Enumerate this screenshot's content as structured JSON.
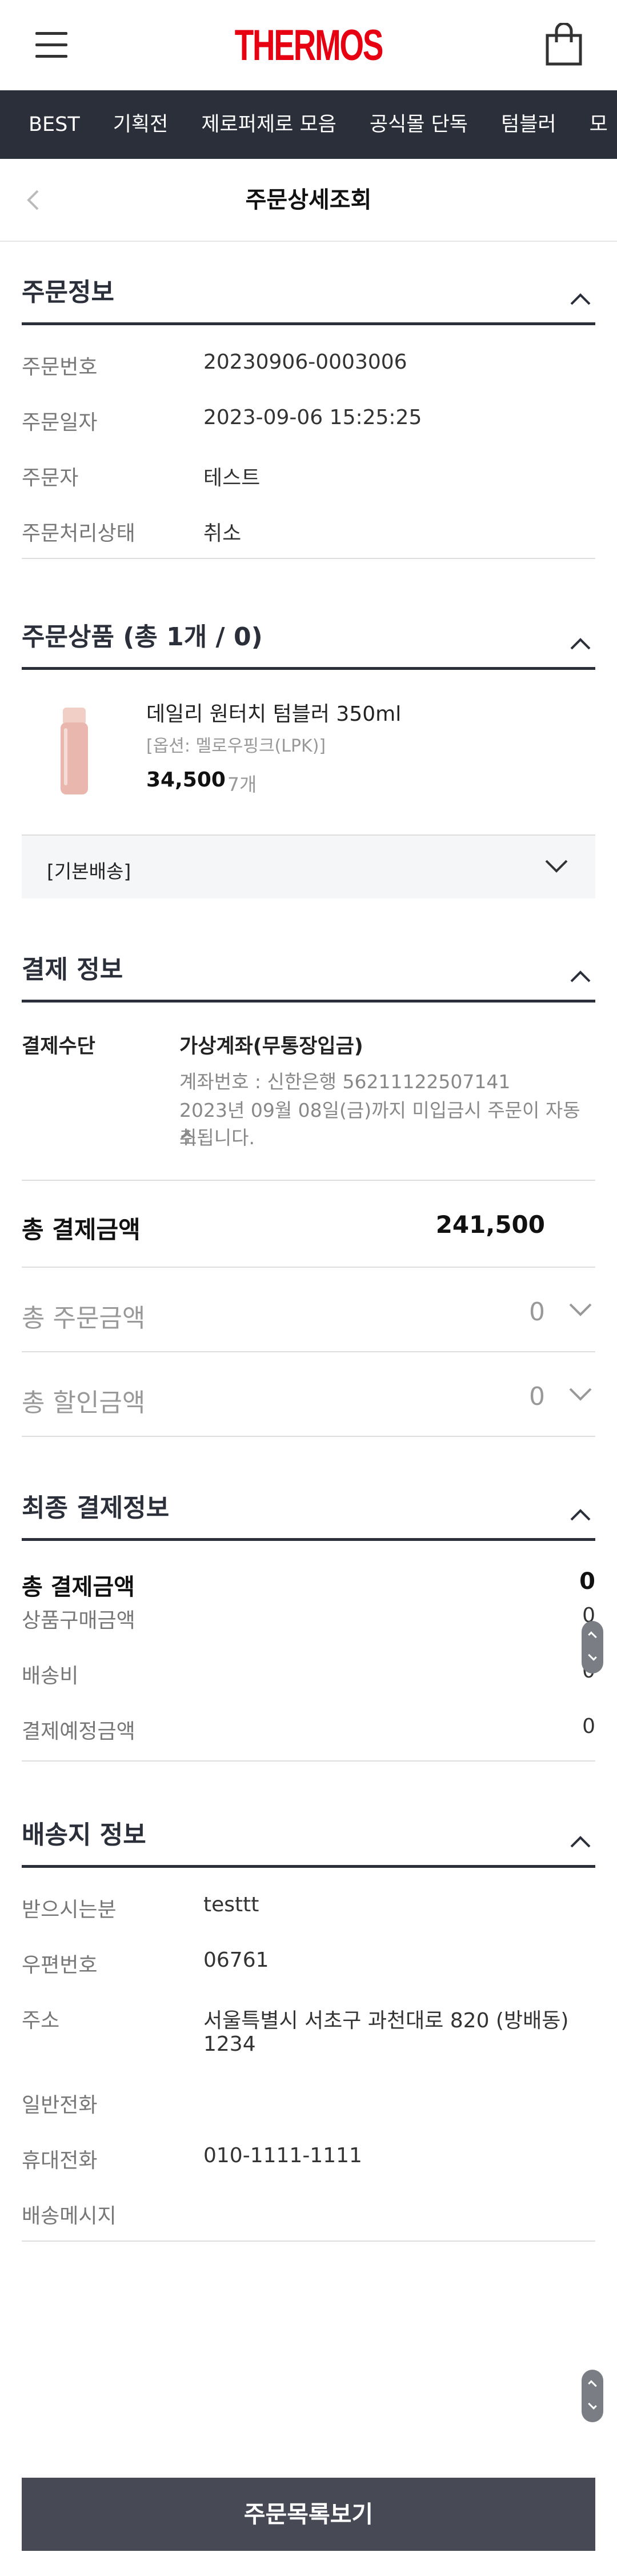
{
  "header": {
    "logo": "THERMOS",
    "menu_icon": "hamburger-icon",
    "cart_icon": "shopping-bag-icon"
  },
  "nav": {
    "items": [
      "BEST",
      "기획전",
      "제로퍼제로 모음",
      "공식몰 단독",
      "텀블러",
      "모"
    ]
  },
  "page": {
    "title": "주문상세조회"
  },
  "order_info": {
    "title": "주문정보",
    "rows": [
      {
        "label": "주문번호",
        "value": "20230906-0003006"
      },
      {
        "label": "주문일자",
        "value": "2023-09-06 15:25:25"
      },
      {
        "label": "주문자",
        "value": "테스트"
      },
      {
        "label": "주문처리상태",
        "value": "취소"
      }
    ]
  },
  "products": {
    "title": "주문상품 (총 1개 / 0)",
    "item": {
      "name": "데일리 원터치 텀블러 350ml",
      "option": "[옵션: 멜로우핑크(LPK)]",
      "price": "34,500",
      "qty": "7개",
      "color": "#e9b7ad"
    },
    "shipping_label": "[기본배송]"
  },
  "payment": {
    "title": "결제 정보",
    "method_label": "결제수단",
    "method": "가상계좌(무통장입금)",
    "account": "계좌번호 : 신한은행 56211122507141",
    "notice_line1": "2023년 09월 08일(금)까지 미입금시 주문이 자동취",
    "notice_line2": "소됩니다.",
    "total_label": "총 결제금액",
    "total_value": "241,500",
    "order_total_label": "총 주문금액",
    "order_total_value": "0",
    "discount_label": "총 할인금액",
    "discount_value": "0"
  },
  "final": {
    "title": "최종 결제정보",
    "total_label": "총 결제금액",
    "total_value": "0",
    "rows": [
      {
        "label": "상품구매금액",
        "value": "0"
      },
      {
        "label": "배송비",
        "value": "0"
      },
      {
        "label": "결제예정금액",
        "value": "0"
      }
    ]
  },
  "delivery": {
    "title": "배송지 정보",
    "recipient_label": "받으시는분",
    "recipient": "testtt",
    "zip_label": "우편번호",
    "zip": "06761",
    "address_label": "주소",
    "address_line1": "서울특별시 서초구 과천대로 820 (방배동)",
    "address_line2": "1234",
    "phone_label": "일반전화",
    "phone": "",
    "mobile_label": "휴대전화",
    "mobile": "010-1111-1111",
    "message_label": "배송메시지",
    "message": ""
  },
  "footer": {
    "list_button": "주문목록보기"
  }
}
